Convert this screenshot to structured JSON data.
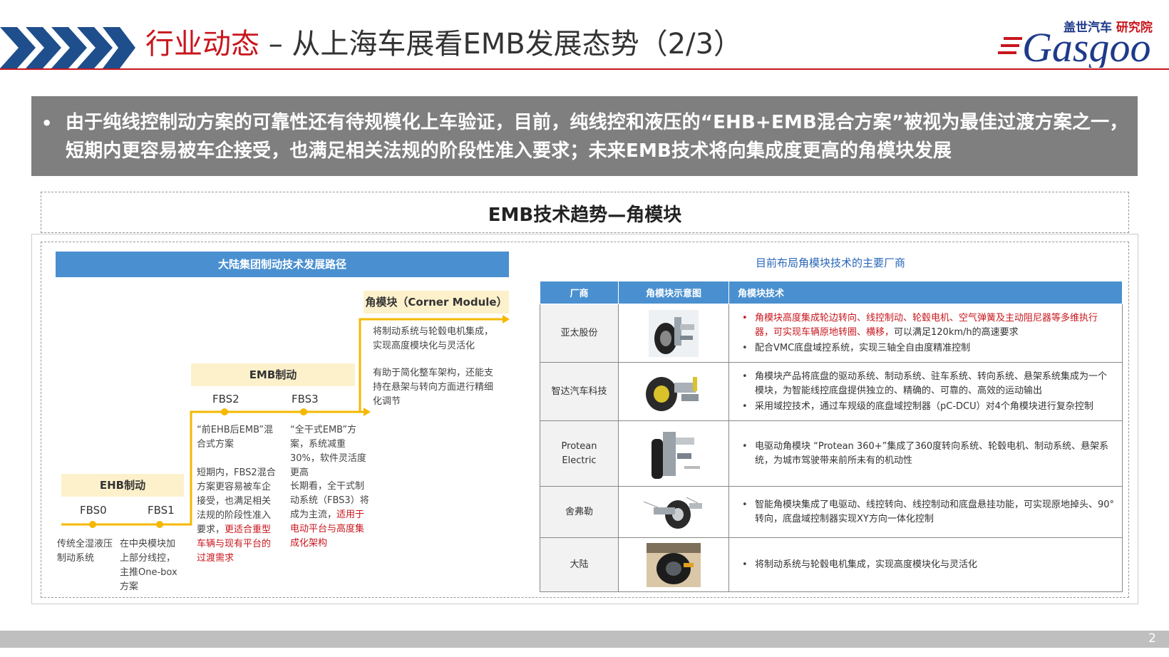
{
  "header": {
    "title_red": "行业动态",
    "title_dark": " – 从上海车展看EMB发展态势（2/3）",
    "logo_cn_a": "盖世汽车",
    "logo_cn_b": "研究院",
    "logo_en": "Gasgoo"
  },
  "banner": {
    "bullet": "•",
    "text": "由于纯线控制动方案的可靠性还有待规模化上车验证，目前，纯线控和液压的“EHB+EMB混合方案”被视为最佳过渡方案之一，短期内更容易被车企接受，也满足相关法规的阶段性准入要求；未来EMB技术将向集成度更高的角模块发展"
  },
  "section_title": "EMB技术趋势—角模块",
  "roadmap": {
    "title": "大陆集团制动技术发展路径",
    "stages": {
      "ehb": "EHB制动",
      "emb": "EMB制动",
      "corner": "角模块（Corner Module）"
    },
    "fbs": {
      "fbs0": "FBS0",
      "fbs1": "FBS1",
      "fbs2": "FBS2",
      "fbs3": "FBS3"
    },
    "desc": {
      "fbs0": "传统全湿液压制动系统",
      "fbs1": "在中央模块加上部分线控，主推One-box方案",
      "fbs2_a": "“前EHB后EMB”混合式方案",
      "fbs2_b": "短期内，FBS2混合方案更容易被车企接受，也满足相关法规的阶段性准入要求，",
      "fbs2_hl": "更适合重型车辆与现有平台的过渡需求",
      "fbs3_a": "“全干式EMB”方案，系统减重30%，软件灵活度更高",
      "fbs3_b": "长期看，全干式制动系统（FBS3）将成为主流，",
      "fbs3_hl": "适用于电动平台与高度集成化架构",
      "corner_a": "将制动系统与轮毂电机集成，实现高度模块化与灵活化",
      "corner_b": "有助于简化整车架构，还能支持在悬架与转向方面进行精细化调节"
    }
  },
  "vendors": {
    "title": "目前布局角模块技术的主要厂商",
    "headers": [
      "厂商",
      "角模块示意图",
      "角模块技术"
    ],
    "rows": [
      {
        "name": "亚太股份",
        "bullets": [
          {
            "text": "角模块高度集成轮边转向、线控制动、轮毂电机、空气弹簧及主动阻尼器等多维执行器，可实现车辆原地转圈、横移，",
            "tail": "可以满足120km/h的高速要求"
          },
          {
            "text": "配合VMC底盘域控系统，实现三轴全自由度精准控制",
            "tail": ""
          }
        ]
      },
      {
        "name": "智达汽车科技",
        "bullets": [
          {
            "text": "角模块产品将底盘的驱动系统、制动系统、驻车系统、转向系统、悬架系统集成为一个模块，为智能线控底盘提供独立的、精确的、可靠的、高效的运动输出",
            "tail": ""
          },
          {
            "text": "采用域控技术，通过车规级的底盘域控制器（pC-DCU）对4个角模块进行复杂控制",
            "tail": ""
          }
        ]
      },
      {
        "name_a": "Protean",
        "name_b": "Electric",
        "bullets": [
          {
            "text": "电驱动角模块 “Protean 360+”集成了360度转向系统、轮毂电机、制动系统、悬架系统，为城市驾驶带来前所未有的机动性",
            "tail": ""
          }
        ]
      },
      {
        "name": "舍弗勒",
        "bullets": [
          {
            "text": "智能角模块集成了电驱动、线控转向、线控制动和底盘悬挂功能，可实现原地掉头、90°转向，底盘域控制器实现XY方向一体化控制",
            "tail": ""
          }
        ]
      },
      {
        "name": "大陆",
        "bullets": [
          {
            "text": "将制动系统与轮毂电机集成，实现高度模块化与灵活化",
            "tail": ""
          }
        ]
      }
    ]
  },
  "page_number": "2",
  "colors": {
    "accent_red": "#c8161d",
    "accent_blue": "#4a90d0",
    "timeline_yellow": "#f5b800"
  }
}
